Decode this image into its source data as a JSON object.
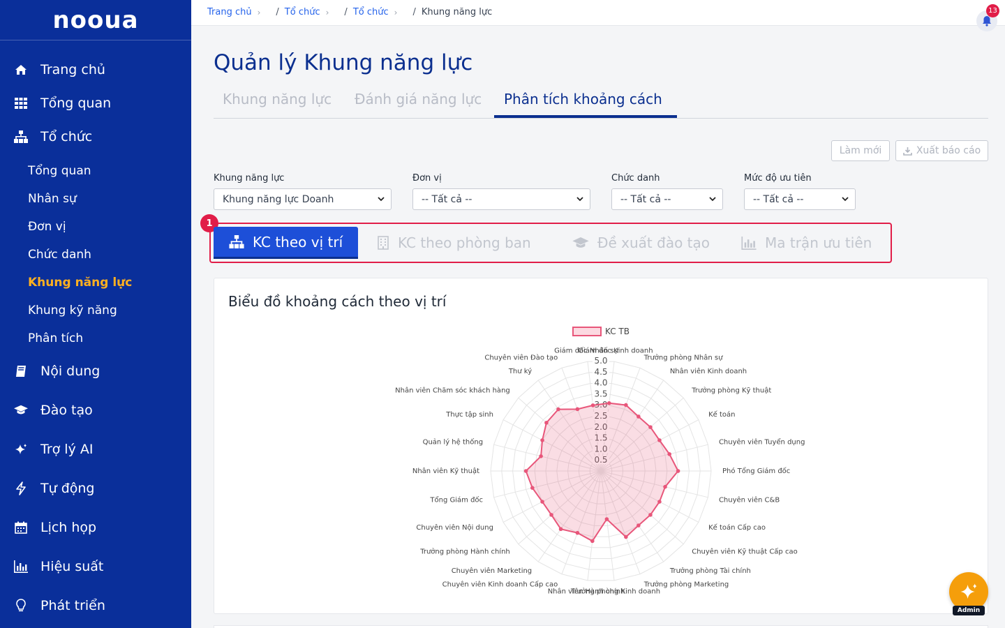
{
  "app": {
    "logo_text": "nooua"
  },
  "sidebar": {
    "items": [
      {
        "label": "Trang chủ",
        "icon": "home-icon"
      },
      {
        "label": "Tổng quan",
        "icon": "grid-icon"
      },
      {
        "label": "Tổ chức",
        "icon": "org-chart-icon"
      },
      {
        "label": "Nội dung",
        "icon": "book-icon"
      },
      {
        "label": "Đào tạo",
        "icon": "graduation-cap-icon"
      },
      {
        "label": "Trợ lý AI",
        "icon": "sparkle-icon"
      },
      {
        "label": "Tự động",
        "icon": "bolt-icon"
      },
      {
        "label": "Lịch họp",
        "icon": "calendar-icon"
      },
      {
        "label": "Hiệu suất",
        "icon": "bar-chart-icon"
      },
      {
        "label": "Phát triển",
        "icon": "lightbulb-icon"
      }
    ],
    "sub_items": [
      {
        "label": "Tổng quan"
      },
      {
        "label": "Nhân sự"
      },
      {
        "label": "Đơn vị"
      },
      {
        "label": "Chức danh"
      },
      {
        "label": "Khung năng lực",
        "active": true
      },
      {
        "label": "Khung kỹ năng"
      },
      {
        "label": "Phân tích"
      }
    ]
  },
  "breadcrumb": {
    "home": "Trang chủ",
    "level1": "Tổ chức",
    "level2": "Tổ chức",
    "current": "Khung năng lực"
  },
  "notifications": {
    "count": "13"
  },
  "page": {
    "title": "Quản lý Khung năng lực"
  },
  "tabs": [
    {
      "label": "Khung năng lực"
    },
    {
      "label": "Đánh giá năng lực"
    },
    {
      "label": "Phân tích khoảng cách",
      "active": true
    }
  ],
  "actions": {
    "refresh": "Làm mới",
    "export": "Xuất báo cáo"
  },
  "filters": {
    "framework": {
      "label": "Khung năng lực",
      "value": "Khung năng lực Doanh"
    },
    "unit": {
      "label": "Đơn vị",
      "value": "-- Tất cả --"
    },
    "title": {
      "label": "Chức danh",
      "value": "-- Tất cả --"
    },
    "priority": {
      "label": "Mức độ ưu tiên",
      "value": "-- Tất cả --"
    }
  },
  "annotation_badge": "1",
  "subtabs": [
    {
      "label": "KC theo vị trí",
      "icon": "org-chart-icon",
      "active": true
    },
    {
      "label": "KC theo phòng ban",
      "icon": "building-icon"
    },
    {
      "label": "Đề xuất đào tạo",
      "icon": "graduation-cap-icon"
    },
    {
      "label": "Ma trận ưu tiên",
      "icon": "bar-chart-icon"
    }
  ],
  "chart_card": {
    "title": "Biểu đồ khoảng cách theo vị trí"
  },
  "chart_data": {
    "type": "radar",
    "legend_position": "top",
    "series": [
      {
        "name": "KC TB",
        "color": "#e8567a",
        "values": [
          3.1,
          3.2,
          3.0,
          3.0,
          3.0,
          3.2,
          3.5,
          3.0,
          3.0,
          3.0,
          3.0,
          3.2,
          2.2,
          3.2,
          3.0,
          3.2,
          3.0,
          3.0,
          3.2,
          3.4,
          2.8,
          3.0,
          3.3,
          3.4,
          3.0,
          3.0
        ]
      }
    ],
    "categories": [
      "Giám đốc Kinh doanh",
      "Trưởng phòng Nhân sự",
      "Nhân viên Kinh doanh",
      "Trưởng phòng Kỹ thuật",
      "Kế toán",
      "Chuyên viên Tuyển dụng",
      "Phó Tổng Giám đốc",
      "Chuyên viên C&B",
      "Kế toán Cấp cao",
      "Chuyên viên Kỹ thuật Cấp cao",
      "Trưởng phòng Tài chính",
      "Trưởng phòng Marketing",
      "Trưởng phòng Kinh doanh",
      "Nhân viên Hành chính",
      "Chuyên viên Kinh doanh Cấp cao",
      "Chuyên viên Marketing",
      "Trưởng phòng Hành chính",
      "Chuyên viên Nội dung",
      "Tổng Giám đốc",
      "Nhân viên Kỹ thuật",
      "Quản lý hệ thống",
      "Thực tập sinh",
      "Nhân viên Chăm sóc khách hàng",
      "Thư ký",
      "Chuyên viên Đào tạo",
      "Giám đốc Nhân sự"
    ],
    "scale_ticks": [
      "0.5",
      "1.0",
      "1.5",
      "2.0",
      "2.5",
      "3.0",
      "3.5",
      "4.0",
      "4.5",
      "5.0"
    ],
    "r_range": [
      0,
      5
    ]
  },
  "fab": {
    "tag": "Admin"
  }
}
